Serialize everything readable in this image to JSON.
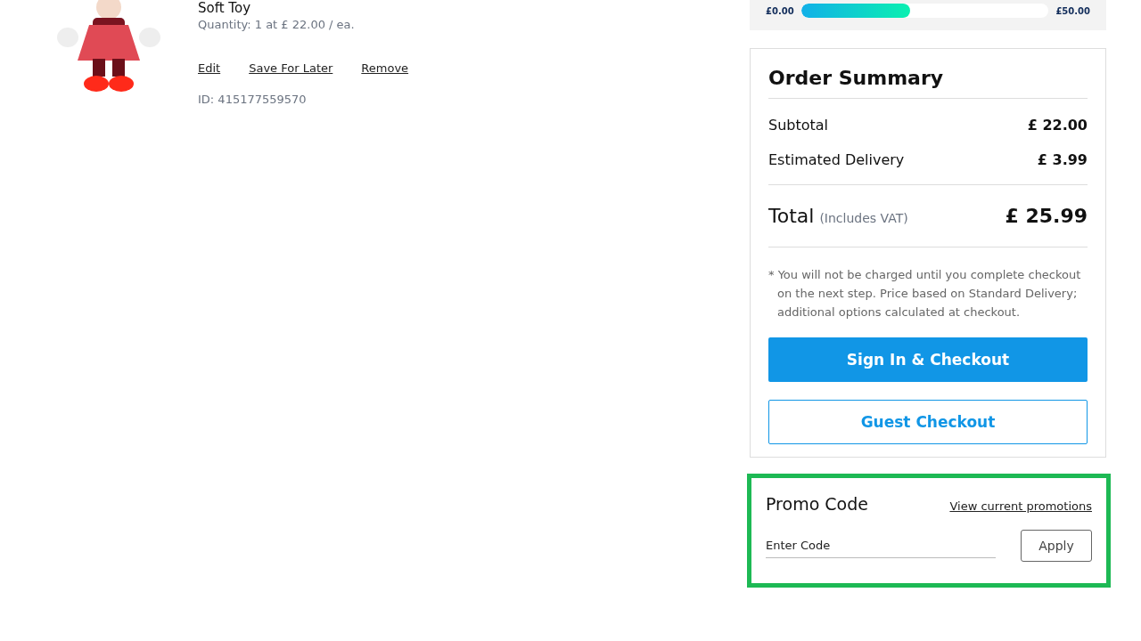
{
  "product": {
    "title": "Soft Toy",
    "quantity": "Quantity: 1 at £ 22.00 / ea.",
    "actions": [
      "Edit",
      "Save For Later",
      "Remove"
    ],
    "id": "ID: 415177559570"
  },
  "delivery_progress": {
    "start": "£0.00",
    "end": "£50.00",
    "level": 0.44
  },
  "order_summary": {
    "title": "Order Summary",
    "rows": [
      {
        "label": "Subtotal",
        "value": "£ 22.00"
      },
      {
        "label": "Estimated Delivery",
        "value": "£ 3.99"
      }
    ],
    "total": {
      "label": "Total",
      "note": "(Includes VAT)",
      "value": "£ 25.99"
    },
    "disclaimer": "* You will not be charged until you complete checkout on the next step. Price based on Standard Delivery; additional options calculated at checkout.",
    "buttons": [
      {
        "kind": "primary",
        "label": "Sign In & Checkout"
      },
      {
        "kind": "secondary",
        "label": "Guest Checkout"
      }
    ]
  },
  "promo": {
    "title": "Promo Code",
    "link": "View current promotions",
    "placeholder": "Enter Code",
    "button": "Apply",
    "highlighted": true
  }
}
